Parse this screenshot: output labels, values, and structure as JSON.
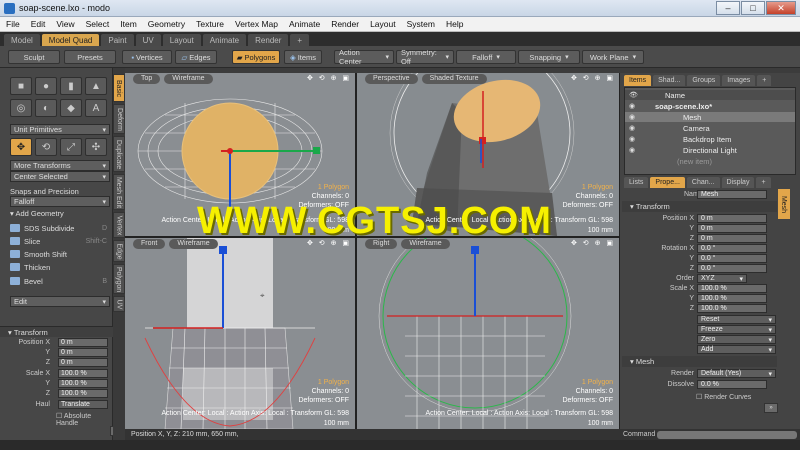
{
  "window": {
    "title": "soap-scene.lxo - modo",
    "min": "–",
    "max": "□",
    "close": "✕"
  },
  "menu": [
    "File",
    "Edit",
    "View",
    "Select",
    "Item",
    "Geometry",
    "Texture",
    "Vertex Map",
    "Animate",
    "Render",
    "Layout",
    "System",
    "Help"
  ],
  "layout_tabs": [
    "Model",
    "Model Quad",
    "Paint",
    "UV",
    "Layout",
    "Animate",
    "Render",
    "+"
  ],
  "toolbar": {
    "sculpt": "Sculpt",
    "presets": "Presets",
    "vertices": "Vertices",
    "edges": "Edges",
    "polygons": "Polygons",
    "items": "Items",
    "action_center": "Action Center",
    "symmetry": "Symmetry: Off",
    "falloff": "Falloff",
    "snapping": "Snapping",
    "work_plane": "Work Plane"
  },
  "left": {
    "vtabs": [
      "Basic",
      "Deform",
      "Duplicate",
      "Mesh Edit",
      "Vertex",
      "Edge",
      "Polygon",
      "UV"
    ],
    "unit_primitives": "Unit Primitives",
    "more_transforms": "More Transforms",
    "center_selected": "Center Selected",
    "snaps_precision": "Snaps and Precision",
    "falloff": "Falloff",
    "add_geometry": "Add Geometry",
    "tools": [
      {
        "label": "SDS Subdivide",
        "shortcut": "D"
      },
      {
        "label": "Slice",
        "shortcut": "Shift-C"
      },
      {
        "label": "Smooth Shift",
        "shortcut": ""
      },
      {
        "label": "Thicken",
        "shortcut": ""
      },
      {
        "label": "Bevel",
        "shortcut": "B"
      }
    ],
    "edit": "Edit",
    "transform_header": "Transform",
    "position_label": "Position X",
    "pos": [
      {
        "axis": "Position X",
        "value": "0 m"
      },
      {
        "axis": "Y",
        "value": "0 m"
      },
      {
        "axis": "Z",
        "value": "0 m"
      }
    ],
    "scale": [
      {
        "axis": "Scale X",
        "value": "100.0 %"
      },
      {
        "axis": "Y",
        "value": "100.0 %"
      },
      {
        "axis": "Z",
        "value": "100.0 %"
      }
    ],
    "haul_label": "Haul",
    "haul_value": "Translate",
    "absolute_handle": "Absolute Handle"
  },
  "viewports": {
    "top": {
      "tabs": [
        "Top",
        "Wireframe"
      ],
      "info": [
        "1 Polygon",
        "Channels: 0",
        "Deformers: OFF"
      ],
      "footer": "Action Center: Local : Action Axis: Local : Transform GL: 598",
      "scale": "100 mm"
    },
    "persp": {
      "tabs": [
        "Perspective",
        "Shaded Texture"
      ],
      "info": [
        "1 Polygon",
        "Channels: 0",
        "Deformers: OFF"
      ],
      "footer": "Action Center: Local : Action Axis: Local : Transform GL: 598",
      "scale": "100 mm"
    },
    "front": {
      "tabs": [
        "Front",
        "Wireframe"
      ],
      "info": [
        "1 Polygon",
        "Channels: 0",
        "Deformers: OFF"
      ],
      "footer": "Action Center: Local : Action Axis: Local : Transform GL: 598",
      "scale": "100 mm"
    },
    "right": {
      "tabs": [
        "Right",
        "Wireframe"
      ],
      "info": [
        "1 Polygon",
        "Channels: 0",
        "Deformers: OFF"
      ],
      "footer": "Action Center: Local : Action Axis: Local : Transform GL: 598",
      "scale": "100 mm"
    },
    "nav_icons": "✥ ⟲ ⊕ ▣"
  },
  "watermark": "WWW.CGTSJ.COM",
  "status": "Position X, Y, Z:   210 mm, 650 mm,",
  "right": {
    "top_tabs": [
      "Items",
      "Shad...",
      "Groups",
      "Images",
      "+"
    ],
    "name_header": "Name",
    "items": [
      {
        "label": "soap-scene.lxo*",
        "selected": false
      },
      {
        "label": "Mesh",
        "selected": true
      },
      {
        "label": "Camera",
        "selected": false
      },
      {
        "label": "Backdrop Item",
        "selected": false
      },
      {
        "label": "Directional Light",
        "selected": false
      },
      {
        "label": "(new item)",
        "selected": false
      }
    ],
    "prop_tabs": [
      "Lists",
      "Prope...",
      "Chan...",
      "Display",
      "+"
    ],
    "name_label": "Name",
    "name_value": "Mesh",
    "mesh_tab": "Mesh",
    "transform": "Transform",
    "position": [
      {
        "axis": "Position X",
        "value": "0 m"
      },
      {
        "axis": "Y",
        "value": "0 m"
      },
      {
        "axis": "Z",
        "value": "0 m"
      }
    ],
    "rotation": [
      {
        "axis": "Rotation X",
        "value": "0.0 °"
      },
      {
        "axis": "Y",
        "value": "0.0 °"
      },
      {
        "axis": "Z",
        "value": "0.0 °"
      }
    ],
    "order_label": "Order",
    "order_value": "XYZ",
    "scale": [
      {
        "axis": "Scale X",
        "value": "100.0 %"
      },
      {
        "axis": "Y",
        "value": "100.0 %"
      },
      {
        "axis": "Z",
        "value": "100.0 %"
      }
    ],
    "actions": [
      "Reset",
      "Freeze",
      "Zero",
      "Add"
    ],
    "mesh_section": "Mesh",
    "render_label": "Render",
    "render_value": "Default (Yes)",
    "dissolve_label": "Dissolve",
    "dissolve_value": "0.0 %",
    "render_curves": "Render Curves",
    "command_label": "Command"
  }
}
